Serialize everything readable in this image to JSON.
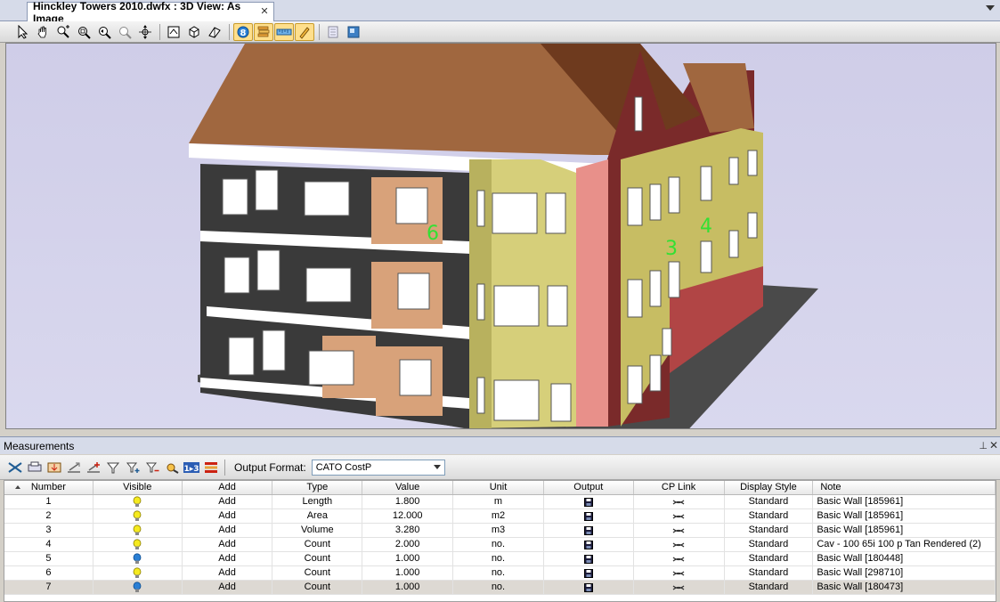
{
  "document_tab": {
    "title": "Hinckley Towers 2010.dwfx : 3D View: As Image"
  },
  "view_toolbar": {
    "buttons": [
      "select-icon",
      "pan-icon",
      "zoom-icon",
      "zoom-window-icon",
      "zoom-previous-icon",
      "zoom-next-icon",
      "orbit-icon",
      "home-view-icon",
      "fit-view-icon",
      "perspective-icon",
      "object-info-icon",
      "layers-icon",
      "measure-icon",
      "markup-pen-icon",
      "properties-icon",
      "display-icon"
    ]
  },
  "viewport": {
    "labels": [
      "6",
      "3",
      "4"
    ],
    "colors": {
      "roof": "#a0673f",
      "bay_yellow": "#d6cf7a",
      "wall_pink": "#e8908a",
      "wall_maroon": "#7a2a2a",
      "ground": "#4a4a4a",
      "label_green": "#33e033"
    }
  },
  "panel": {
    "title": "Measurements"
  },
  "meas_toolbar": {
    "output_format_label": "Output Format:",
    "output_format_value": "CATO CostP"
  },
  "grid": {
    "columns": [
      "Number",
      "Visible",
      "Add",
      "Type",
      "Value",
      "Unit",
      "Output",
      "CP Link",
      "Display Style",
      "Note"
    ],
    "rows": [
      {
        "number": "1",
        "visible": "yellow",
        "add": "Add",
        "type": "Length",
        "value": "1.800",
        "unit": "m",
        "display_style": "Standard",
        "note": "Basic Wall [185961]"
      },
      {
        "number": "2",
        "visible": "yellow",
        "add": "Add",
        "type": "Area",
        "value": "12.000",
        "unit": "m2",
        "display_style": "Standard",
        "note": "Basic Wall [185961]"
      },
      {
        "number": "3",
        "visible": "yellow",
        "add": "Add",
        "type": "Volume",
        "value": "3.280",
        "unit": "m3",
        "display_style": "Standard",
        "note": "Basic Wall [185961]"
      },
      {
        "number": "4",
        "visible": "yellow",
        "add": "Add",
        "type": "Count",
        "value": "2.000",
        "unit": "no.",
        "display_style": "Standard",
        "note": "Cav - 100 65i 100 p  Tan Rendered (2)"
      },
      {
        "number": "5",
        "visible": "blue",
        "add": "Add",
        "type": "Count",
        "value": "1.000",
        "unit": "no.",
        "display_style": "Standard",
        "note": "Basic Wall [180448]"
      },
      {
        "number": "6",
        "visible": "yellow",
        "add": "Add",
        "type": "Count",
        "value": "1.000",
        "unit": "no.",
        "display_style": "Standard",
        "note": "Basic Wall [298710]"
      },
      {
        "number": "7",
        "visible": "blue",
        "add": "Add",
        "type": "Count",
        "value": "1.000",
        "unit": "no.",
        "display_style": "Standard",
        "note": "Basic Wall [180473]"
      }
    ],
    "selected_row": 6
  }
}
